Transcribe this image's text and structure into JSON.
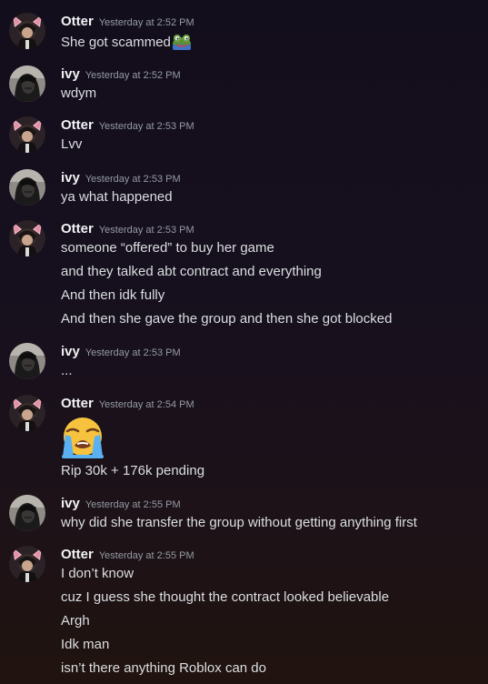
{
  "users": {
    "otter": {
      "name": "Otter",
      "avatar_icon": "otter-avatar-icon"
    },
    "ivy": {
      "name": "ivy",
      "avatar_icon": "ivy-avatar-icon"
    }
  },
  "messages": [
    {
      "author": "Otter",
      "time": "Yesterday at 2:52 PM",
      "lines": [
        "She got scammed"
      ],
      "inline_emoji": "frog-emoji-icon"
    },
    {
      "author": "ivy",
      "time": "Yesterday at 2:52 PM",
      "lines": [
        "wdym"
      ]
    },
    {
      "author": "Otter",
      "time": "Yesterday at 2:53 PM",
      "lines": [
        "Lvv"
      ]
    },
    {
      "author": "ivy",
      "time": "Yesterday at 2:53 PM",
      "lines": [
        "ya what happened"
      ]
    },
    {
      "author": "Otter",
      "time": "Yesterday at 2:53 PM",
      "lines": [
        "someone “offered” to buy her game",
        "and they talked abt contract and everything",
        "And then idk fully",
        "And then she gave the group and then she got blocked"
      ]
    },
    {
      "author": "ivy",
      "time": "Yesterday at 2:53 PM",
      "lines": [
        "..."
      ]
    },
    {
      "author": "Otter",
      "time": "Yesterday at 2:54 PM",
      "jumbo_emoji": "loudly-crying-face-emoji-icon",
      "lines": [
        "Rip 30k + 176k pending"
      ]
    },
    {
      "author": "ivy",
      "time": "Yesterday at 2:55 PM",
      "lines": [
        "why did she transfer the group without getting anything first"
      ]
    },
    {
      "author": "Otter",
      "time": "Yesterday at 2:55 PM",
      "lines": [
        "I don’t know",
        "cuz I guess she thought the contract looked believable",
        "Argh",
        "Idk man",
        "isn’t there anything Roblox can do"
      ]
    }
  ],
  "colors": {
    "author": "#f2f3f5",
    "timestamp": "#949ba4",
    "text": "#dbdee1",
    "background_top": "#130e1c",
    "background_bottom": "#20130f"
  }
}
